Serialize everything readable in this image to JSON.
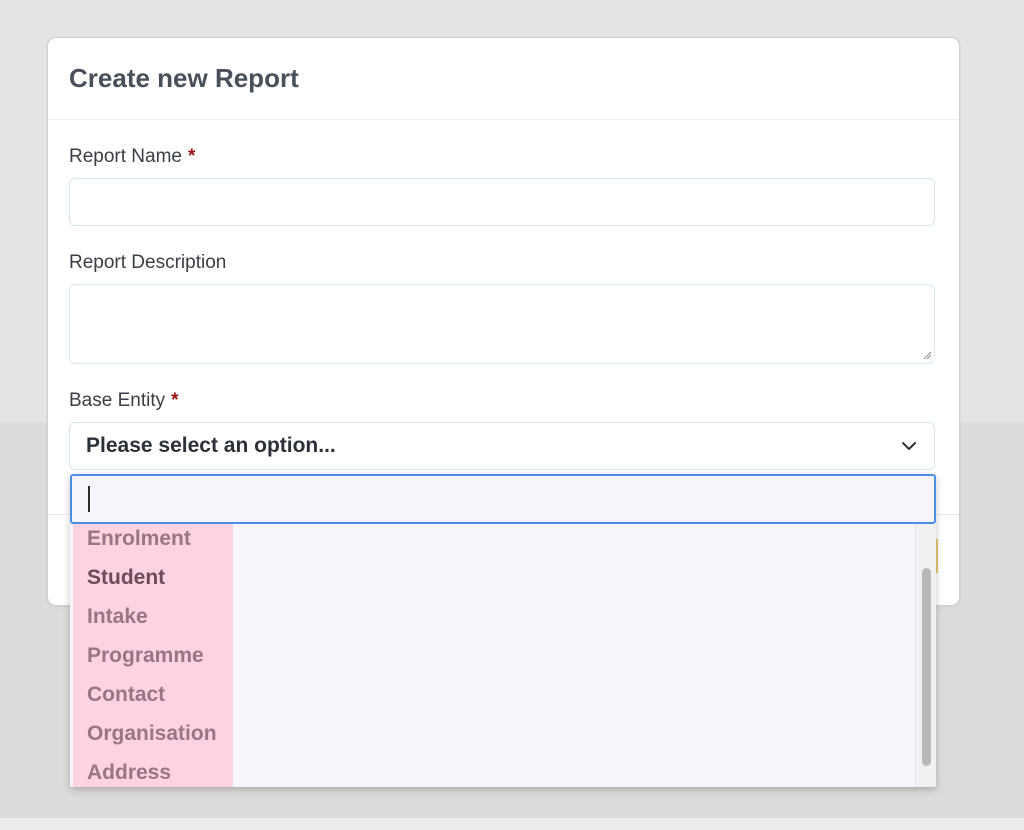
{
  "modal": {
    "title": "Create new Report",
    "fields": {
      "report_name": {
        "label": "Report Name",
        "required_mark": "*",
        "value": ""
      },
      "report_description": {
        "label": "Report Description",
        "value": ""
      },
      "base_entity": {
        "label": "Base Entity",
        "required_mark": "*",
        "selected": "Please select an option...",
        "icon": "chevron-down-icon"
      }
    }
  },
  "dropdown": {
    "search_value": "",
    "options": [
      "Enrolment",
      "Student",
      "Intake",
      "Programme",
      "Contact",
      "Organisation",
      "Address"
    ],
    "highlighted_option": "Student"
  },
  "colors": {
    "accent": "#4a8fe3",
    "required": "#9b1212",
    "option_highlight": "#fdd3e1"
  }
}
